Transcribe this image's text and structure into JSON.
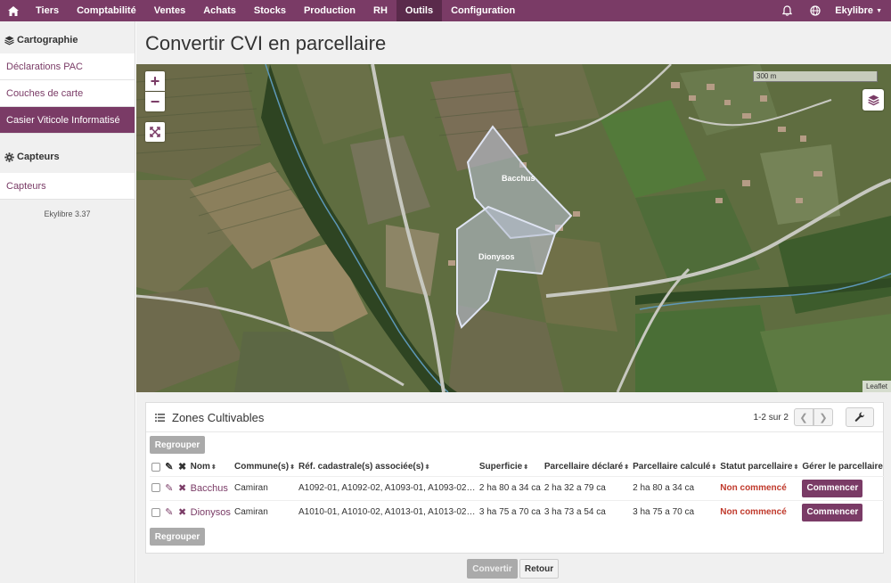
{
  "topnav": {
    "items": [
      "Tiers",
      "Comptabilité",
      "Ventes",
      "Achats",
      "Stocks",
      "Production",
      "RH",
      "Outils",
      "Configuration"
    ],
    "active": "Outils",
    "user": "Ekylibre",
    "icons": [
      "home-icon",
      "bell-icon",
      "globe-icon",
      "caret-down-icon"
    ]
  },
  "sidebar": {
    "group1": "Cartographie",
    "group1_items": [
      "Déclarations PAC",
      "Couches de carte",
      "Casier Viticole Informatisé"
    ],
    "group2": "Capteurs",
    "group2_items": [
      "Capteurs"
    ],
    "version": "Ekylibre 3.37"
  },
  "page": {
    "title": "Convertir CVI en parcellaire"
  },
  "map": {
    "scale_label": "300 m",
    "attribution": "Leaflet",
    "parcel_labels": [
      "Bacchus",
      "Dionysos"
    ],
    "zoom_in": "+",
    "zoom_out": "−"
  },
  "panel": {
    "title": "Zones Cultivables",
    "pagination": "1-2 sur 2",
    "group_button": "Regrouper",
    "columns": [
      "Nom",
      "Commune(s)",
      "Réf. cadastrale(s) associée(s)",
      "Superficie",
      "Parcellaire déclaré",
      "Parcellaire calculé",
      "Statut parcellaire",
      "Gérer le parcellaire"
    ],
    "rows": [
      {
        "nom": "Bacchus",
        "commune": "Camiran",
        "ref": "A1092-01, A1092-02, A1093-01, A1093-02…",
        "superficie": "2 ha 80 a 34 ca",
        "declare": "2 ha 32 a 79 ca",
        "calcule": "2 ha 80 a 34 ca",
        "statut": "Non commencé",
        "action": "Commencer"
      },
      {
        "nom": "Dionysos",
        "commune": "Camiran",
        "ref": "A1010-01, A1010-02, A1013-01, A1013-02…",
        "superficie": "3 ha 75 a 70 ca",
        "declare": "3 ha 73 a 54 ca",
        "calcule": "3 ha 75 a 70 ca",
        "statut": "Non commencé",
        "action": "Commencer"
      }
    ]
  },
  "footer": {
    "convert": "Convertir",
    "back": "Retour"
  },
  "colors": {
    "brand": "#7a3b66",
    "brand_dark": "#5a2a4b",
    "status": "#c0392b"
  }
}
